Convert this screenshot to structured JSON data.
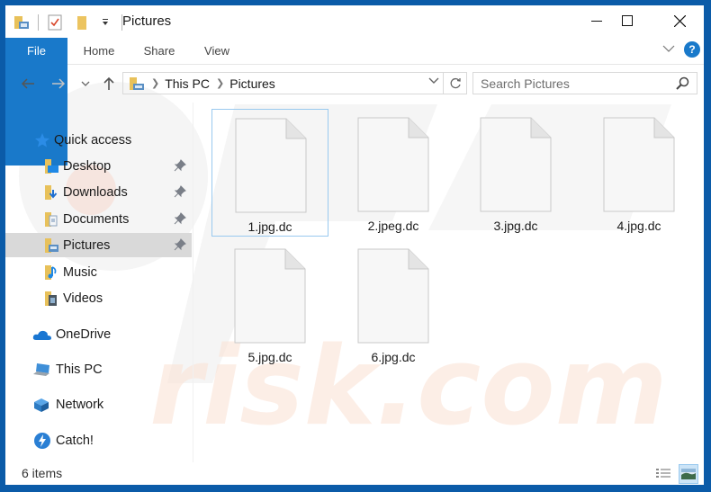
{
  "window": {
    "title": "Pictures",
    "controls": {
      "minimize": "minimize",
      "maximize": "maximize",
      "close": "close"
    }
  },
  "quick_access_toolbar": {
    "icons": [
      "explorer-folder-icon",
      "properties-icon",
      "new-folder-icon",
      "customize-dropdown-icon"
    ]
  },
  "ribbon": {
    "tabs": [
      {
        "label": "File",
        "active": true
      },
      {
        "label": "Home",
        "active": false
      },
      {
        "label": "Share",
        "active": false
      },
      {
        "label": "View",
        "active": false
      }
    ],
    "help_label": "?"
  },
  "navigation": {
    "breadcrumb": [
      "This PC",
      "Pictures"
    ],
    "search_placeholder": "Search Pictures"
  },
  "sidebar": {
    "quick_access_label": "Quick access",
    "pinned": [
      {
        "label": "Desktop",
        "icon": "desktop-folder-icon",
        "pinned": true,
        "selected": false
      },
      {
        "label": "Downloads",
        "icon": "downloads-folder-icon",
        "pinned": true,
        "selected": false
      },
      {
        "label": "Documents",
        "icon": "documents-folder-icon",
        "pinned": true,
        "selected": false
      },
      {
        "label": "Pictures",
        "icon": "pictures-folder-icon",
        "pinned": true,
        "selected": true
      },
      {
        "label": "Music",
        "icon": "music-folder-icon",
        "pinned": false,
        "selected": false
      },
      {
        "label": "Videos",
        "icon": "videos-folder-icon",
        "pinned": false,
        "selected": false
      }
    ],
    "locations": [
      {
        "label": "OneDrive",
        "icon": "onedrive-icon"
      },
      {
        "label": "This PC",
        "icon": "this-pc-icon"
      },
      {
        "label": "Network",
        "icon": "network-icon"
      },
      {
        "label": "Catch!",
        "icon": "catch-icon"
      }
    ]
  },
  "files": [
    {
      "name": "1.jpg.dc",
      "focused": true
    },
    {
      "name": "2.jpeg.dc",
      "focused": false
    },
    {
      "name": "3.jpg.dc",
      "focused": false
    },
    {
      "name": "4.jpg.dc",
      "focused": false
    },
    {
      "name": "5.jpg.dc",
      "focused": false
    },
    {
      "name": "6.jpg.dc",
      "focused": false
    }
  ],
  "status": {
    "item_count": "6 items",
    "view_modes": [
      "details",
      "large-icons"
    ],
    "active_view": "large-icons"
  },
  "colors": {
    "window_border": "#0b5ba8",
    "accent": "#1979ca",
    "selected_nav": "#d9d9d9",
    "focus_border": "#99c9ef"
  }
}
